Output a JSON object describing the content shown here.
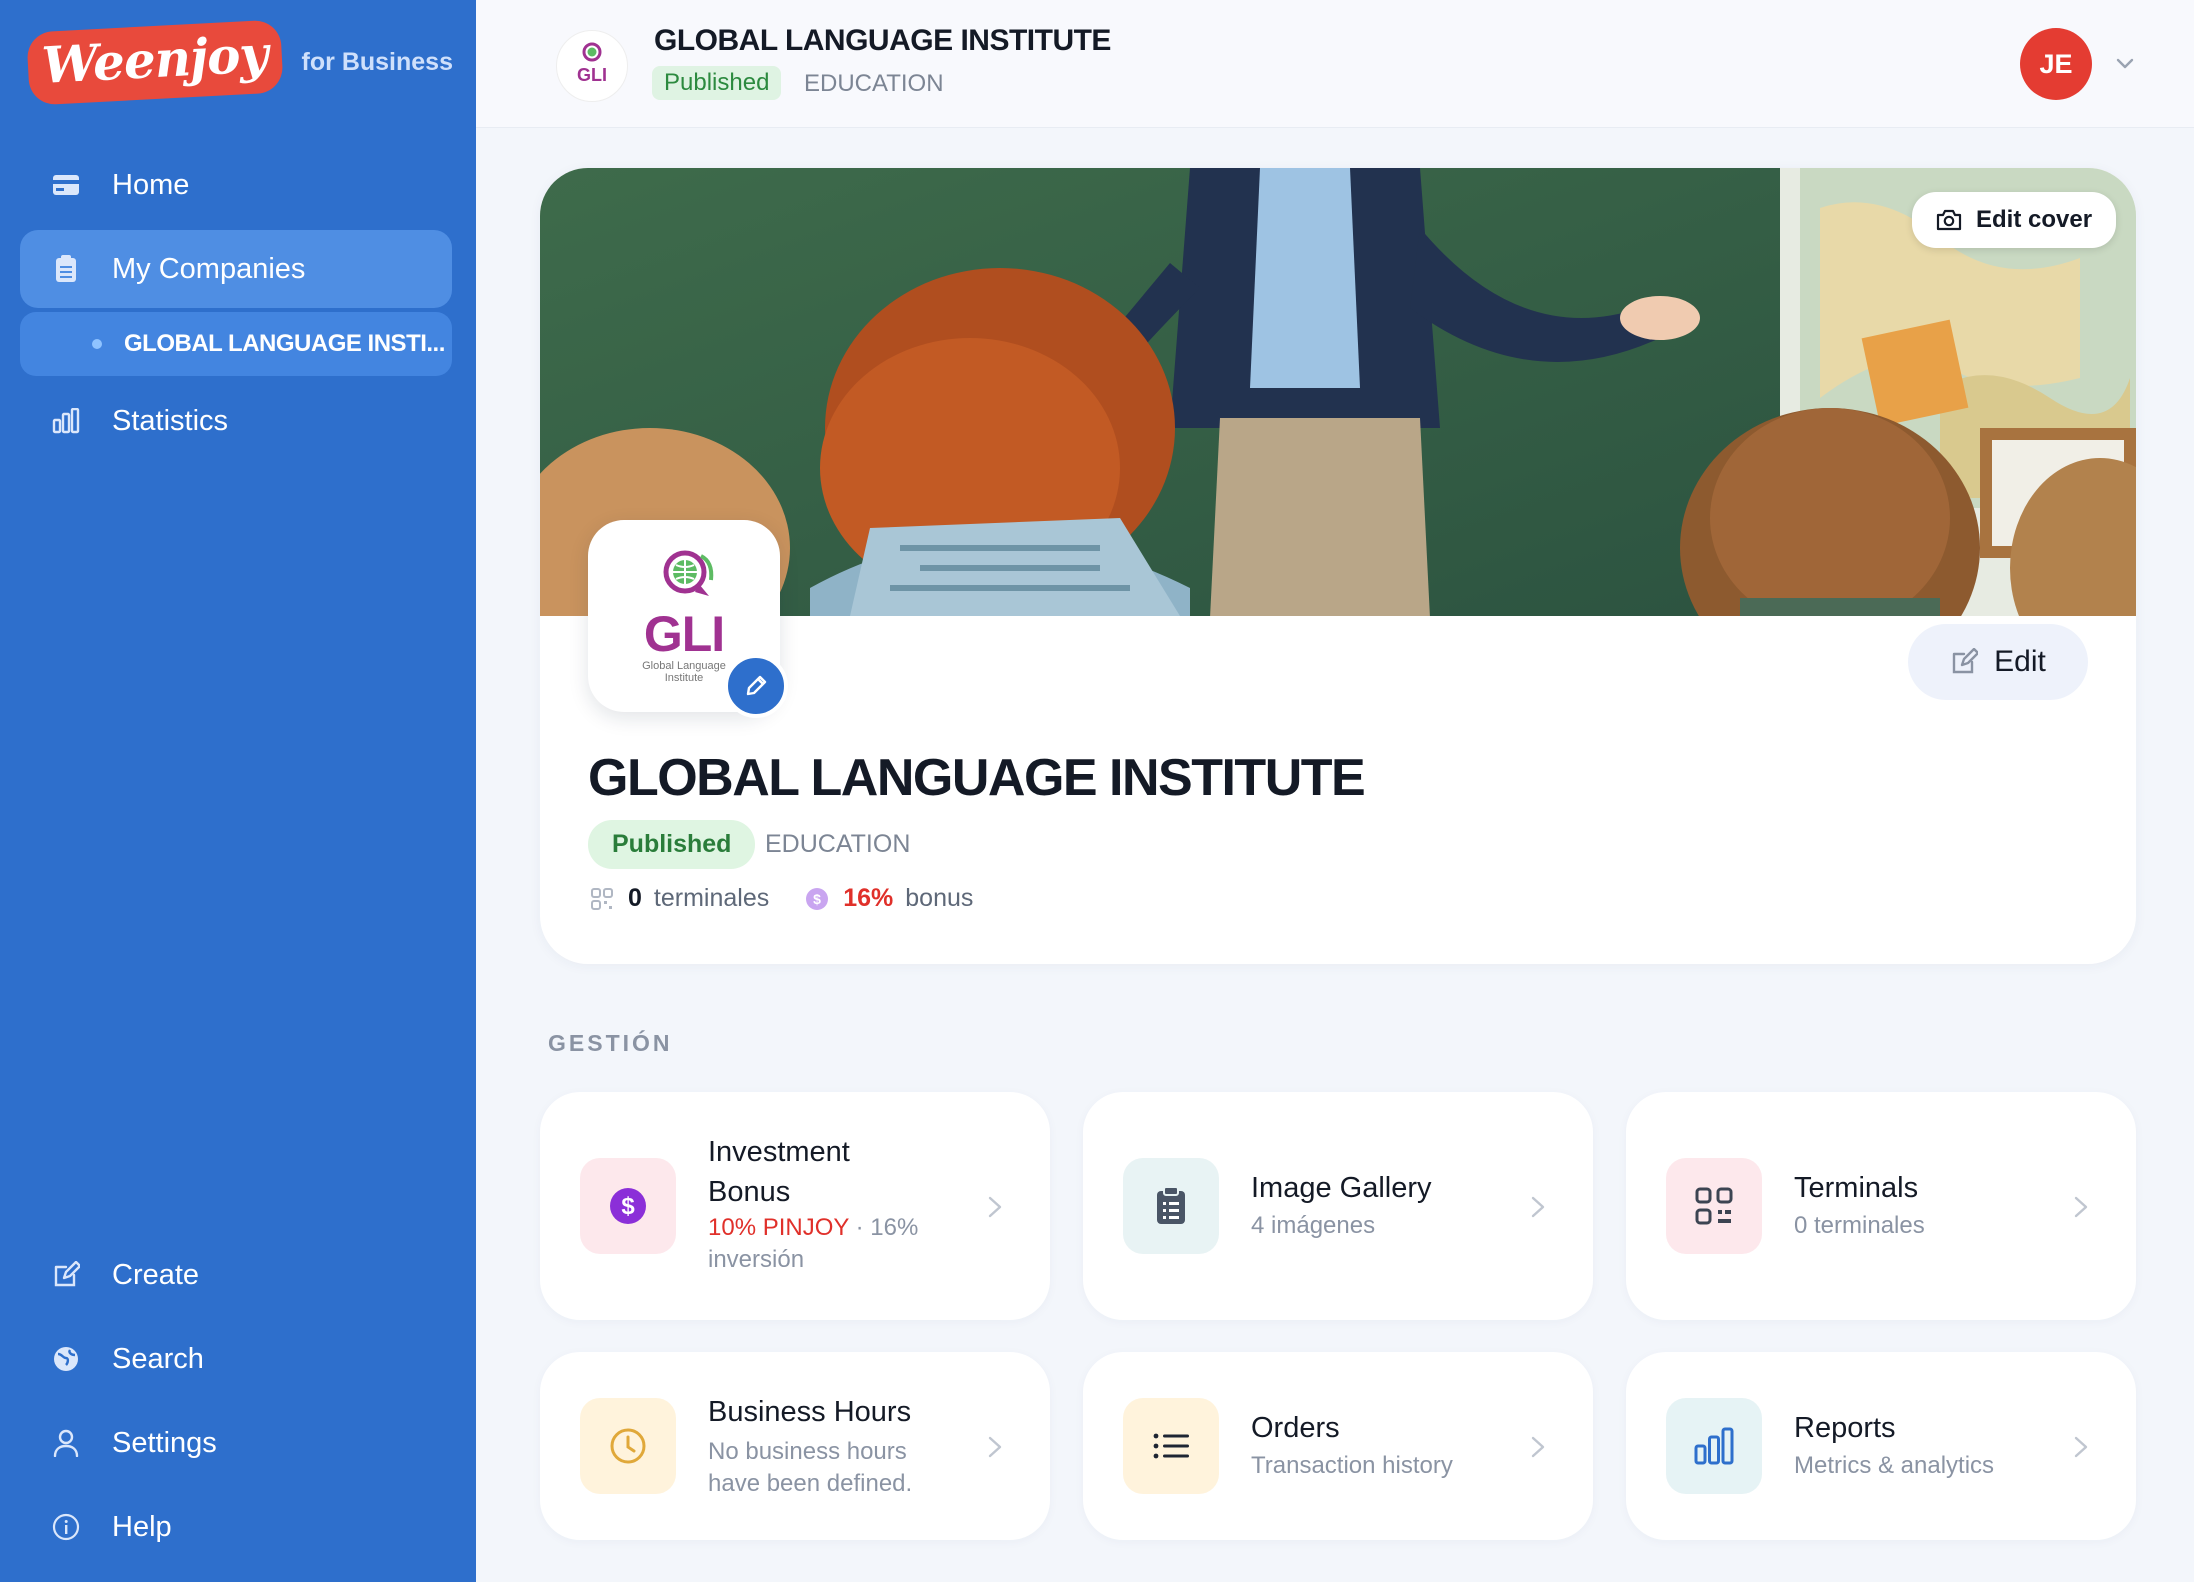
{
  "brand": {
    "logo_text": "Weenjoy",
    "subtitle": "for Business"
  },
  "sidebar": {
    "items": [
      {
        "label": "Home",
        "icon": "credit-card-icon"
      },
      {
        "label": "My Companies",
        "icon": "clipboard-icon",
        "active": true
      },
      {
        "label": "Statistics",
        "icon": "bar-chart-icon"
      }
    ],
    "sub_item": {
      "label": "GLOBAL LANGUAGE INSTI..."
    },
    "bottom_items": [
      {
        "label": "Create",
        "icon": "edit-icon"
      },
      {
        "label": "Search",
        "icon": "globe-icon"
      },
      {
        "label": "Settings",
        "icon": "user-icon"
      },
      {
        "label": "Help",
        "icon": "info-icon"
      }
    ]
  },
  "header": {
    "company_name": "GLOBAL LANGUAGE INSTITUTE",
    "status": "Published",
    "category": "EDUCATION",
    "avatar_initials": "JE"
  },
  "hero": {
    "edit_cover_label": "Edit cover",
    "edit_label": "Edit",
    "title": "GLOBAL LANGUAGE INSTITUTE",
    "status": "Published",
    "category": "EDUCATION",
    "logo_text": "GLI",
    "logo_caption_1": "Global Language",
    "logo_caption_2": "Institute",
    "terminals_count": "0",
    "terminals_label": "terminales",
    "bonus_value": "16%",
    "bonus_label": "bonus"
  },
  "section": {
    "title": "GESTIÓN"
  },
  "cards": [
    {
      "title_line1": "Investment",
      "title_line2": "Bonus",
      "highlight": "10% PINJOY",
      "sub_inline": "· 16%",
      "sub_line2": "inversión",
      "icon": "dollar-icon",
      "icon_color": "#8b2fd8",
      "bg": "#fde8ec"
    },
    {
      "title": "Image Gallery",
      "sub": "4 imágenes",
      "icon": "clipboard-icon",
      "icon_color": "#4a5566",
      "bg": "#e8f3f4"
    },
    {
      "title": "Terminals",
      "sub": "0 terminales",
      "icon": "qr-code-icon",
      "icon_color": "#3c4452",
      "bg": "#fde8ec"
    },
    {
      "title": "Business Hours",
      "sub_line1": "No business hours",
      "sub_line2": "have been defined.",
      "icon": "clock-icon",
      "icon_color": "#e0a83a",
      "bg": "#fff3dc"
    },
    {
      "title": "Orders",
      "sub": "Transaction history",
      "icon": "list-icon",
      "icon_color": "#1e2533",
      "bg": "#fff3dc"
    },
    {
      "title": "Reports",
      "sub": "Metrics & analytics",
      "icon": "bar-chart-icon",
      "icon_color": "#2e6fcc",
      "bg": "#e6f3f5"
    }
  ]
}
